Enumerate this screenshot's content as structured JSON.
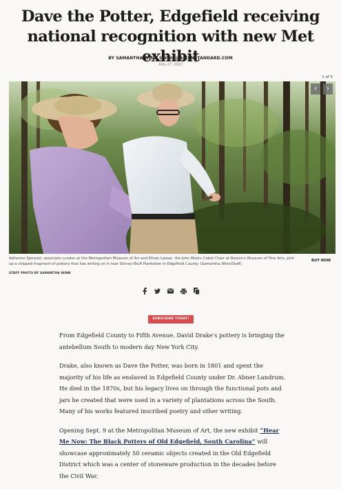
{
  "article": {
    "headline": "Dave the Potter, Edgefield receiving national recognition with new Met exhibit",
    "byline": "BY SAMANTHA WINN SWINN@AIKENSTANDARD.COM",
    "date": "AUG 27, 2022"
  },
  "gallery": {
    "counter": "1 of 5",
    "prev_icon": "chevron-left-icon",
    "next_icon": "chevron-right-icon",
    "prev_glyph": "‹",
    "next_glyph": "›",
    "caption": "Adrienne Spinozzi, associate curator at the Metropolitan Museum of Art and Ethan Lasser, the John Moors Cabot Chair at Boston's Museum of Fine Arts, pick up a chipped fragment of pottery that has writing on it near Stoney Bluff Plantation in Edgefield County. (Samantha Winn/Staff).",
    "buy_now": "BUY NOW",
    "credit": "STAFF PHOTO BY SAMANTHA WINN"
  },
  "share": {
    "icons": [
      "facebook-icon",
      "twitter-icon",
      "email-icon",
      "print-icon",
      "copy-icon"
    ]
  },
  "subscribe": {
    "label": "SUBSCRIBE TODAY!",
    "color": "#d84b4e"
  },
  "body": {
    "p1": "From Edgefield County to Fifth Avenue, David Drake's pottery is bringing the antebellum South to modern day New York City.",
    "p2": "Drake, also known as Dave the Potter, was born in 1801 and spent the majority of his life as enslaved in Edgefield County under Dr. Abner Landrum. He died in the 1870s, but his legacy lives on through the functional pots and jars he created that were used in a variety of plantations across the South. Many of his works featured inscribed poetry and other writing.",
    "p4_before": "Opening Sept. 9 at the Metropolitan Museum of Art, the new exhibit ",
    "p4_link": "“Hear Me Now: The Black Potters of Old Edgefield, South Carolina”",
    "p4_after": " will showcase approximately 50 ceramic objects created in the Old Edgefield District which was a center of stoneware production in the decades before the Civil War."
  },
  "colors": {
    "background": "#f9f8f6",
    "link": "#1d2f55"
  }
}
